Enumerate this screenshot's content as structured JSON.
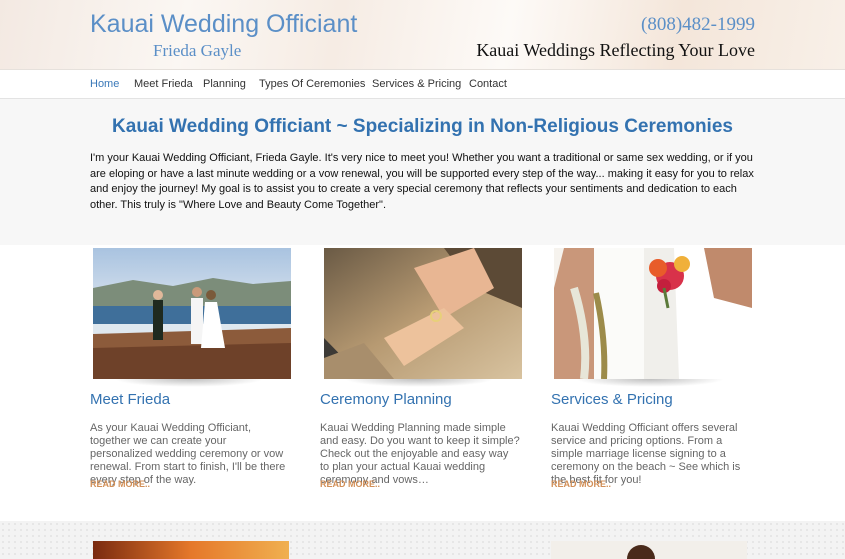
{
  "header": {
    "site_title": "Kauai Wedding Officiant",
    "site_subtitle": "Frieda Gayle",
    "phone": "(808)482-1999",
    "tagline": "Kauai Weddings Reflecting Your Love"
  },
  "nav": {
    "items": [
      {
        "label": "Home"
      },
      {
        "label": "Meet Frieda"
      },
      {
        "label": "Planning"
      },
      {
        "label": "Types Of Ceremonies"
      },
      {
        "label": "Services & Pricing"
      },
      {
        "label": "Contact"
      }
    ]
  },
  "intro": {
    "heading": "Kauai Wedding Officiant ~ Specializing in Non-Religious Ceremonies",
    "text": "I'm your Kauai Wedding Officiant, Frieda Gayle.  It's very nice to meet you!  Whether you want a traditional or same sex wedding, or if you are eloping or have a last minute wedding or a vow renewal, you will be supported every step of the way... making it easy for you to relax and enjoy the journey!  My goal is to assist you to create a very special ceremony that reflects your sentiments and dedication to each other.  This truly is \"Where Love and Beauty Come Together\"."
  },
  "features": [
    {
      "title": "Meet Frieda",
      "text": "As your Kauai Wedding Officiant, together we can create your personalized wedding ceremony or vow renewal. From start to finish, I'll be there every step of the way.",
      "more": "READ MORE.."
    },
    {
      "title": "Ceremony Planning",
      "text": "Kauai Wedding Planning made simple and easy. Do you want to keep it simple? Check out the enjoyable and easy way to plan your actual Kauai wedding ceremony and vows…",
      "more": "READ MORE.."
    },
    {
      "title": "Services & Pricing",
      "text": "Kauai Wedding Officiant offers several service and pricing options.  From a simple marriage license signing to a ceremony on the beach ~ See which is the best fit for you!",
      "more": "READ MORE.."
    }
  ],
  "colors": {
    "accent_blue": "#3372b0",
    "title_blue": "#5b8fc7",
    "read_more": "#d28f57"
  }
}
